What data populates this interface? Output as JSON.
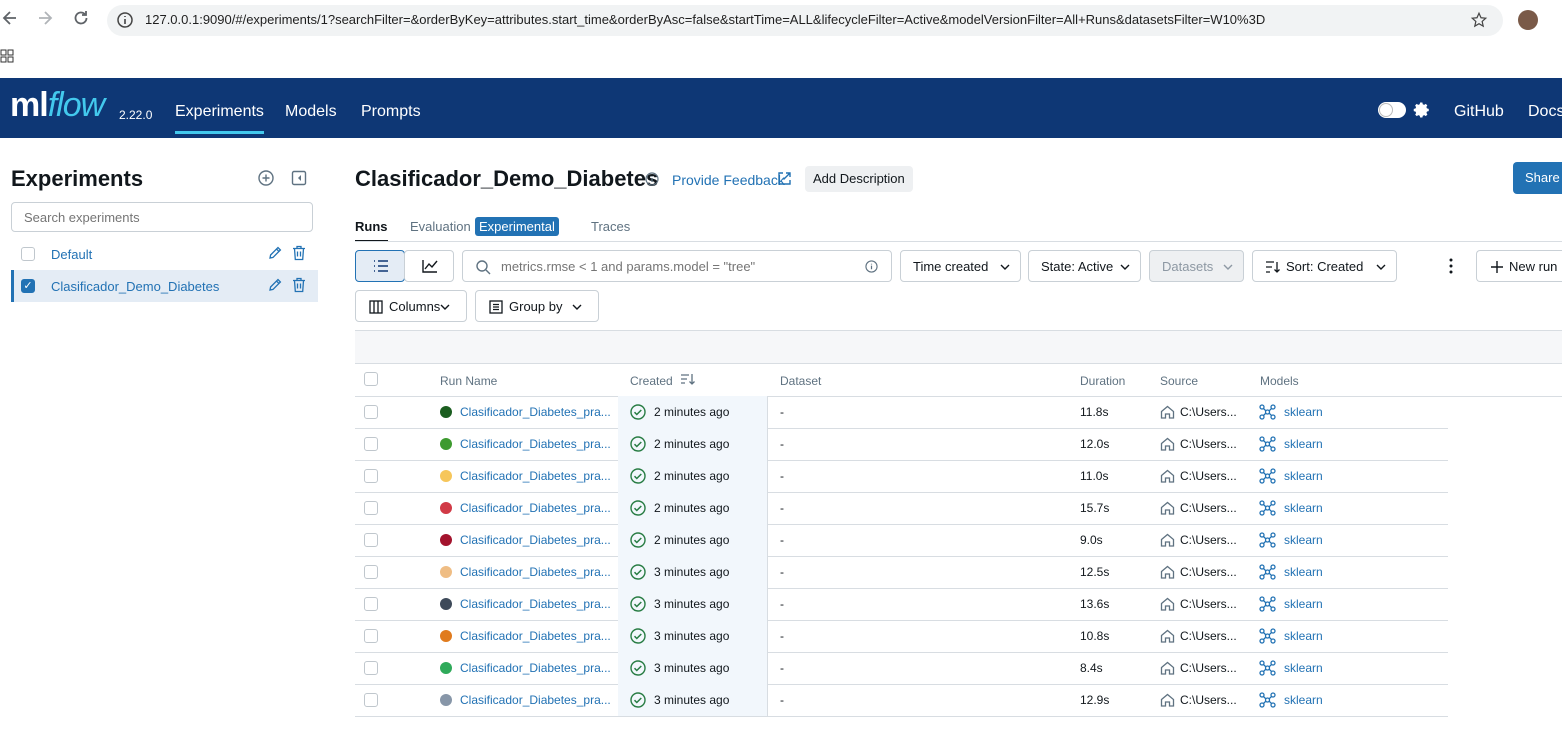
{
  "browser": {
    "url": "127.0.0.1:9090/#/experiments/1?searchFilter=&orderByKey=attributes.start_time&orderByAsc=false&startTime=ALL&lifecycleFilter=Active&modelVersionFilter=All+Runs&datasetsFilter=W10%3D"
  },
  "header": {
    "logo_ml": "ml",
    "logo_flow": "flow",
    "version": "2.22.0",
    "nav": [
      "Experiments",
      "Models",
      "Prompts"
    ],
    "github": "GitHub",
    "docs": "Docs"
  },
  "sidebar": {
    "title": "Experiments",
    "search_placeholder": "Search experiments",
    "experiments": [
      {
        "name": "Default",
        "selected": false
      },
      {
        "name": "Clasificador_Demo_Diabetes",
        "selected": true
      }
    ]
  },
  "main": {
    "title": "Clasificador_Demo_Diabetes",
    "feedback": "Provide Feedback",
    "add_description": "Add Description",
    "share": "Share",
    "tabs": {
      "runs": "Runs",
      "evaluation": "Evaluation",
      "experimental": "Experimental",
      "traces": "Traces"
    },
    "search_placeholder": "metrics.rmse < 1 and params.model = \"tree\"",
    "time_created": "Time created",
    "state": "State: Active",
    "datasets": "Datasets",
    "sort": "Sort: Created",
    "new_run": "New run",
    "columns": "Columns",
    "group_by": "Group by"
  },
  "table": {
    "headers": {
      "run_name": "Run Name",
      "created": "Created",
      "dataset": "Dataset",
      "duration": "Duration",
      "source": "Source",
      "models": "Models"
    },
    "rows": [
      {
        "name": "Clasificador_Diabetes_pra...",
        "color": "#1b5e20",
        "created": "2 minutes ago",
        "dataset": "-",
        "duration": "11.8s",
        "source": "C:\\Users...",
        "model": "sklearn"
      },
      {
        "name": "Clasificador_Diabetes_pra...",
        "color": "#3d9a2f",
        "created": "2 minutes ago",
        "dataset": "-",
        "duration": "12.0s",
        "source": "C:\\Users...",
        "model": "sklearn"
      },
      {
        "name": "Clasificador_Diabetes_pra...",
        "color": "#f6c65b",
        "created": "2 minutes ago",
        "dataset": "-",
        "duration": "11.0s",
        "source": "C:\\Users...",
        "model": "sklearn"
      },
      {
        "name": "Clasificador_Diabetes_pra...",
        "color": "#d13a46",
        "created": "2 minutes ago",
        "dataset": "-",
        "duration": "15.7s",
        "source": "C:\\Users...",
        "model": "sklearn"
      },
      {
        "name": "Clasificador_Diabetes_pra...",
        "color": "#a3132d",
        "created": "2 minutes ago",
        "dataset": "-",
        "duration": "9.0s",
        "source": "C:\\Users...",
        "model": "sklearn"
      },
      {
        "name": "Clasificador_Diabetes_pra...",
        "color": "#efbd84",
        "created": "3 minutes ago",
        "dataset": "-",
        "duration": "12.5s",
        "source": "C:\\Users...",
        "model": "sklearn"
      },
      {
        "name": "Clasificador_Diabetes_pra...",
        "color": "#3e4a5a",
        "created": "3 minutes ago",
        "dataset": "-",
        "duration": "13.6s",
        "source": "C:\\Users...",
        "model": "sklearn"
      },
      {
        "name": "Clasificador_Diabetes_pra...",
        "color": "#e07b1e",
        "created": "3 minutes ago",
        "dataset": "-",
        "duration": "10.8s",
        "source": "C:\\Users...",
        "model": "sklearn"
      },
      {
        "name": "Clasificador_Diabetes_pra...",
        "color": "#2faa5a",
        "created": "3 minutes ago",
        "dataset": "-",
        "duration": "8.4s",
        "source": "C:\\Users...",
        "model": "sklearn"
      },
      {
        "name": "Clasificador_Diabetes_pra...",
        "color": "#8796a8",
        "created": "3 minutes ago",
        "dataset": "-",
        "duration": "12.9s",
        "source": "C:\\Users...",
        "model": "sklearn"
      }
    ]
  }
}
